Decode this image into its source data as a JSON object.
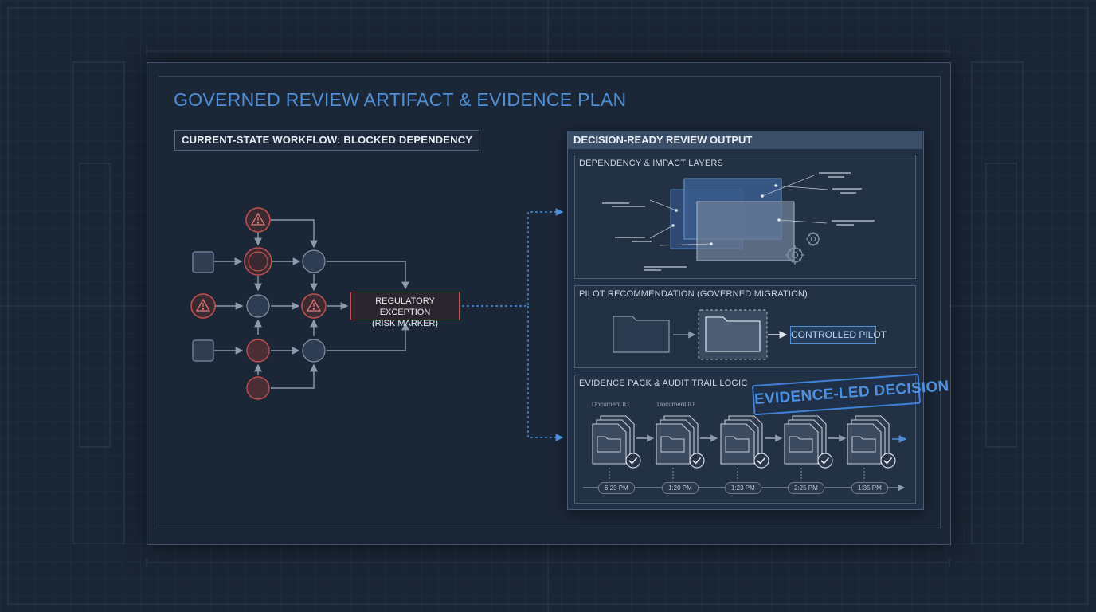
{
  "title": "GOVERNED REVIEW ARTIFACT & EVIDENCE PLAN",
  "left_section": {
    "header": "CURRENT-STATE WORKFLOW: BLOCKED DEPENDENCY",
    "risk_box": {
      "line1": "REGULATORY EXCEPTION",
      "line2": "(RISK MARKER)"
    }
  },
  "right_section": {
    "header": "DECISION-READY REVIEW OUTPUT",
    "dependency": {
      "title": "DEPENDENCY & IMPACT LAYERS"
    },
    "pilot": {
      "title": "PILOT RECOMMENDATION (GOVERNED MIGRATION)",
      "box_label": "CONTROLLED PILOT"
    },
    "evidence": {
      "title": "EVIDENCE PACK & AUDIT TRAIL LOGIC",
      "stamp": "EVIDENCE-LED DECISION",
      "doc_labels": [
        "Document ID",
        "Document ID"
      ],
      "timestamps": [
        "6:23 PM",
        "1:20 PM",
        "1:23 PM",
        "2:25 PM",
        "1:35 PM"
      ]
    }
  },
  "colors": {
    "accent_blue": "#4e8fd6",
    "risk_red": "#c0504f",
    "background": "#1a2535"
  }
}
